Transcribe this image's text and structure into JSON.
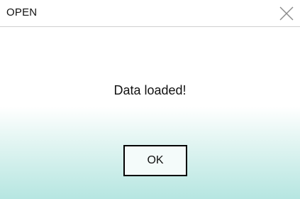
{
  "window": {
    "title": "OPEN",
    "close_icon": "close-x-icon"
  },
  "dialog": {
    "message": "Data loaded!",
    "ok_label": "OK"
  },
  "colors": {
    "title_border": "#cfcfcf",
    "gradient_top": "#ffffff",
    "gradient_bottom": "#b6e6e1",
    "button_border": "#000000",
    "text": "#111111"
  }
}
